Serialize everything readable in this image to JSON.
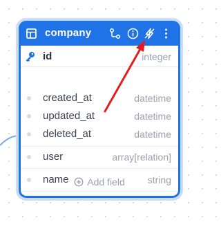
{
  "model": {
    "title": "company",
    "icons": {
      "table": "table-grid-icon",
      "relations": "relation-flow-icon",
      "info": "info-circle-icon",
      "lightning": "lightning-bolt-icon",
      "menu": "more-vertical-icon"
    }
  },
  "fields": [
    {
      "name": "id",
      "type": "integer",
      "primary": true,
      "icon": "key-icon"
    },
    {
      "name": "created_at",
      "type": "datetime"
    },
    {
      "name": "updated_at",
      "type": "datetime"
    },
    {
      "name": "deleted_at",
      "type": "datetime"
    },
    {
      "name": "user",
      "type": "array[relation]"
    },
    {
      "name": "name",
      "type": "string"
    }
  ],
  "add_field": {
    "label": "Add field",
    "icon": "plus-circle-icon"
  },
  "colors": {
    "header": "#1f73e6",
    "accent_arrow": "#e11d1d",
    "key": "#1f73e6"
  }
}
